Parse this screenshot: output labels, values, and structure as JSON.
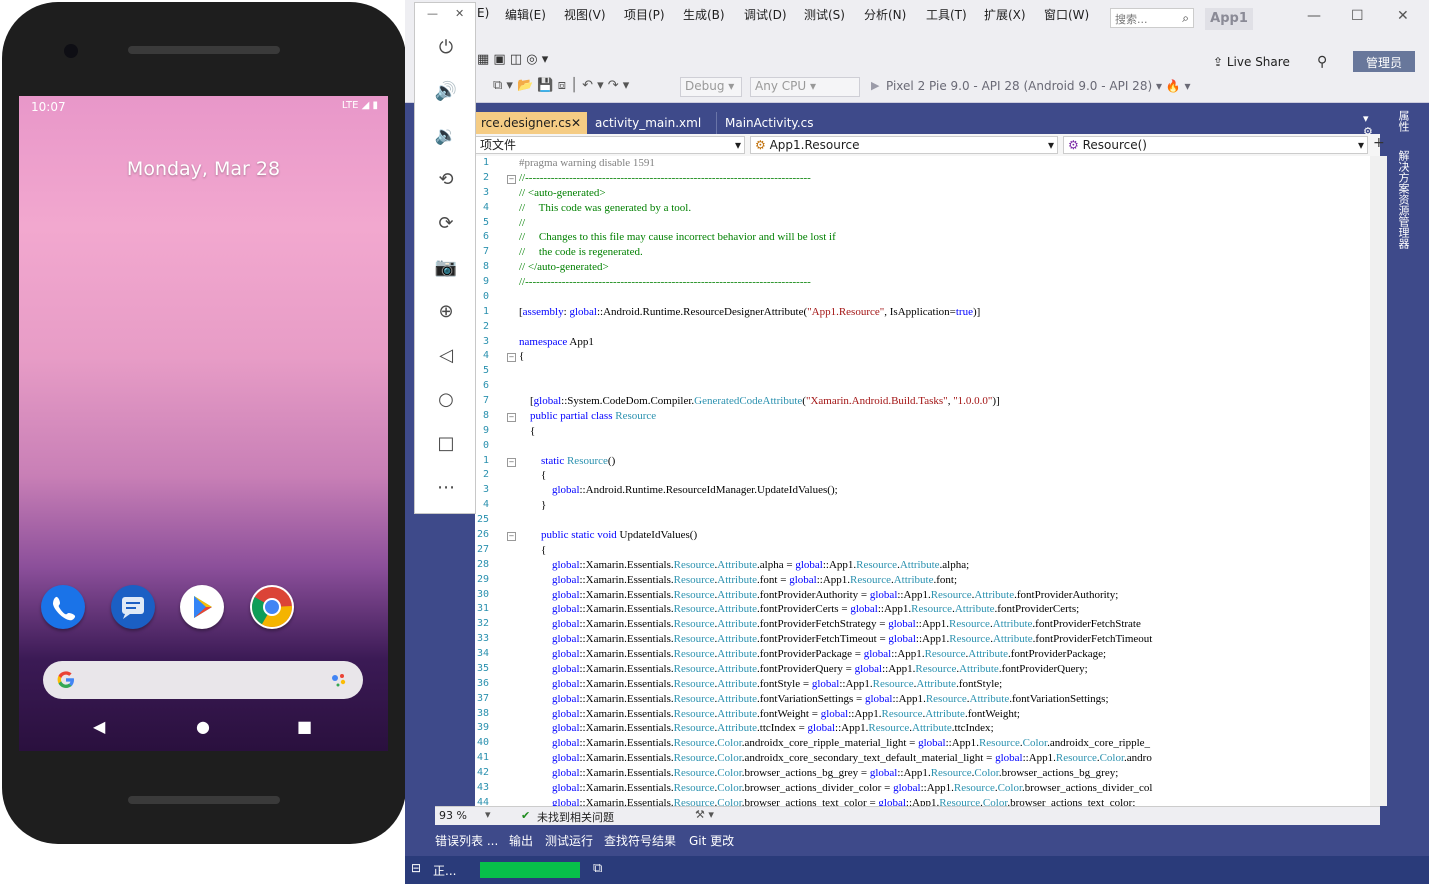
{
  "vs": {
    "menus": [
      "编辑(E)",
      "视图(V)",
      "项目(P)",
      "生成(B)",
      "调试(D)",
      "测试(S)",
      "分析(N)",
      "工具(T)",
      "扩展(X)",
      "窗口(W)"
    ],
    "search_placeholder": "搜索...",
    "solution_name": "App1",
    "live_share": "Live Share",
    "admin": "管理员",
    "config": "Debug",
    "platform": "Any CPU",
    "device_target": "Pixel 2 Pie 9.0 - API 28 (Android 9.0 - API 28)",
    "tabs": [
      "rce.designer.cs",
      "activity_main.xml",
      "MainActivity.cs"
    ],
    "nav": {
      "left": "项文件",
      "middle": "App1.Resource",
      "right": "Resource()"
    },
    "zoom": "93 %",
    "issues": "未找到相关问题",
    "bottom_tabs": [
      "错误列表 ...",
      "输出",
      "测试运行",
      "查找符号结果",
      "Git 更改"
    ],
    "status": "正...",
    "side_panel_props": "属性",
    "side_panel_solution": "解决方案资源管理器",
    "line_numbers": [
      "1",
      "2",
      "3",
      "4",
      "5",
      "6",
      "7",
      "8",
      "9",
      "0",
      "1",
      "2",
      "3",
      "4",
      "5",
      "6",
      "7",
      "8",
      "9",
      "0",
      "1",
      "2",
      "3",
      "4",
      "25",
      "26",
      "27",
      "28",
      "29",
      "30",
      "31",
      "32",
      "33",
      "34",
      "35",
      "36",
      "37",
      "38",
      "39",
      "40",
      "41",
      "42",
      "43",
      "44"
    ],
    "code": [
      "#pragma warning disable 1591",
      "//------------------------------------------------------------------------------",
      "// <auto-generated>",
      "//     This code was generated by a tool.",
      "//",
      "//     Changes to this file may cause incorrect behavior and will be lost if",
      "//     the code is regenerated.",
      "// </auto-generated>",
      "//------------------------------------------------------------------------------",
      "",
      "[assembly: global::Android.Runtime.ResourceDesignerAttribute(\"App1.Resource\", IsApplication=true)]",
      "",
      "namespace App1",
      "{",
      "",
      "",
      "    [global::System.CodeDom.Compiler.GeneratedCodeAttribute(\"Xamarin.Android.Build.Tasks\", \"1.0.0.0\")]",
      "    public partial class Resource",
      "    {",
      "",
      "        static Resource()",
      "        {",
      "            global::Android.Runtime.ResourceIdManager.UpdateIdValues();",
      "        }",
      "",
      "        public static void UpdateIdValues()",
      "        {",
      "            global::Xamarin.Essentials.Resource.Attribute.alpha = global::App1.Resource.Attribute.alpha;",
      "            global::Xamarin.Essentials.Resource.Attribute.font = global::App1.Resource.Attribute.font;",
      "            global::Xamarin.Essentials.Resource.Attribute.fontProviderAuthority = global::App1.Resource.Attribute.fontProviderAuthority;",
      "            global::Xamarin.Essentials.Resource.Attribute.fontProviderCerts = global::App1.Resource.Attribute.fontProviderCerts;",
      "            global::Xamarin.Essentials.Resource.Attribute.fontProviderFetchStrategy = global::App1.Resource.Attribute.fontProviderFetchStrate",
      "            global::Xamarin.Essentials.Resource.Attribute.fontProviderFetchTimeout = global::App1.Resource.Attribute.fontProviderFetchTimeout",
      "            global::Xamarin.Essentials.Resource.Attribute.fontProviderPackage = global::App1.Resource.Attribute.fontProviderPackage;",
      "            global::Xamarin.Essentials.Resource.Attribute.fontProviderQuery = global::App1.Resource.Attribute.fontProviderQuery;",
      "            global::Xamarin.Essentials.Resource.Attribute.fontStyle = global::App1.Resource.Attribute.fontStyle;",
      "            global::Xamarin.Essentials.Resource.Attribute.fontVariationSettings = global::App1.Resource.Attribute.fontVariationSettings;",
      "            global::Xamarin.Essentials.Resource.Attribute.fontWeight = global::App1.Resource.Attribute.fontWeight;",
      "            global::Xamarin.Essentials.Resource.Attribute.ttcIndex = global::App1.Resource.Attribute.ttcIndex;",
      "            global::Xamarin.Essentials.Resource.Color.androidx_core_ripple_material_light = global::App1.Resource.Color.androidx_core_ripple_",
      "            global::Xamarin.Essentials.Resource.Color.androidx_core_secondary_text_default_material_light = global::App1.Resource.Color.andro",
      "            global::Xamarin.Essentials.Resource.Color.browser_actions_bg_grey = global::App1.Resource.Color.browser_actions_bg_grey;",
      "            global::Xamarin.Essentials.Resource.Color.browser_actions_divider_color = global::App1.Resource.Color.browser_actions_divider_col",
      "            global::Xamarin.Essentials.Resource.Color.browser_actions_text_color = global::App1.Resource.Color.browser_actions_text_color;"
    ]
  },
  "emulator": {
    "tools": [
      "power-icon",
      "volume-up-icon",
      "volume-down-icon",
      "rotate-left-icon",
      "rotate-right-icon",
      "camera-icon",
      "zoom-icon",
      "back-icon",
      "home-icon",
      "overview-icon",
      "more-icon"
    ]
  },
  "phone": {
    "time": "10:07",
    "status": "LTE",
    "date": "Monday, Mar 28",
    "apps": [
      "phone-icon",
      "messages-icon",
      "play-store-icon",
      "chrome-icon"
    ]
  },
  "colors": {
    "vs_chrome": "#eeeef2",
    "vs_accent": "#3e4a8a",
    "tab_active": "#f5cc84",
    "status_green": "#08c04a"
  }
}
